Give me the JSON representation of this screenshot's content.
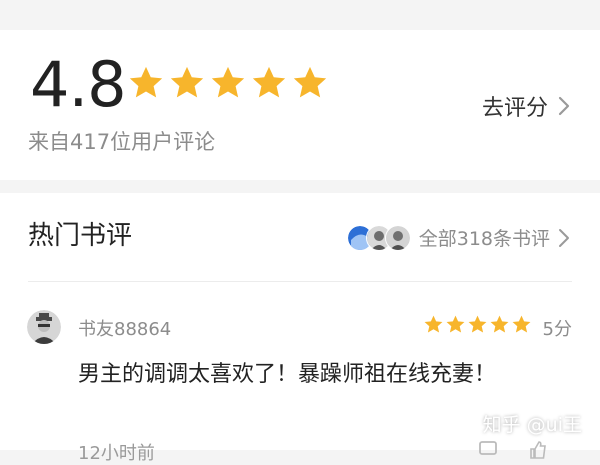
{
  "rating": {
    "score": "4.8",
    "stars": 5,
    "source_text": "来自417位用户评论",
    "rate_label": "去评分"
  },
  "reviews": {
    "section_title": "热门书评",
    "all_label": "全部318条书评",
    "items": [
      {
        "user": "书友88864",
        "stars": 5,
        "score_label": "5分",
        "text": "男主的调调太喜欢了！暴躁师祖在线充妻！",
        "time": "12小时前"
      }
    ]
  },
  "watermark": {
    "text": "知乎 @ui王"
  },
  "colors": {
    "star": "#f7b52c",
    "muted": "#8c8c8c",
    "text": "#222222",
    "divider": "#ececec"
  },
  "icons": [
    "star-icon",
    "chevron-right-icon",
    "avatar",
    "comment-icon",
    "like-icon"
  ]
}
